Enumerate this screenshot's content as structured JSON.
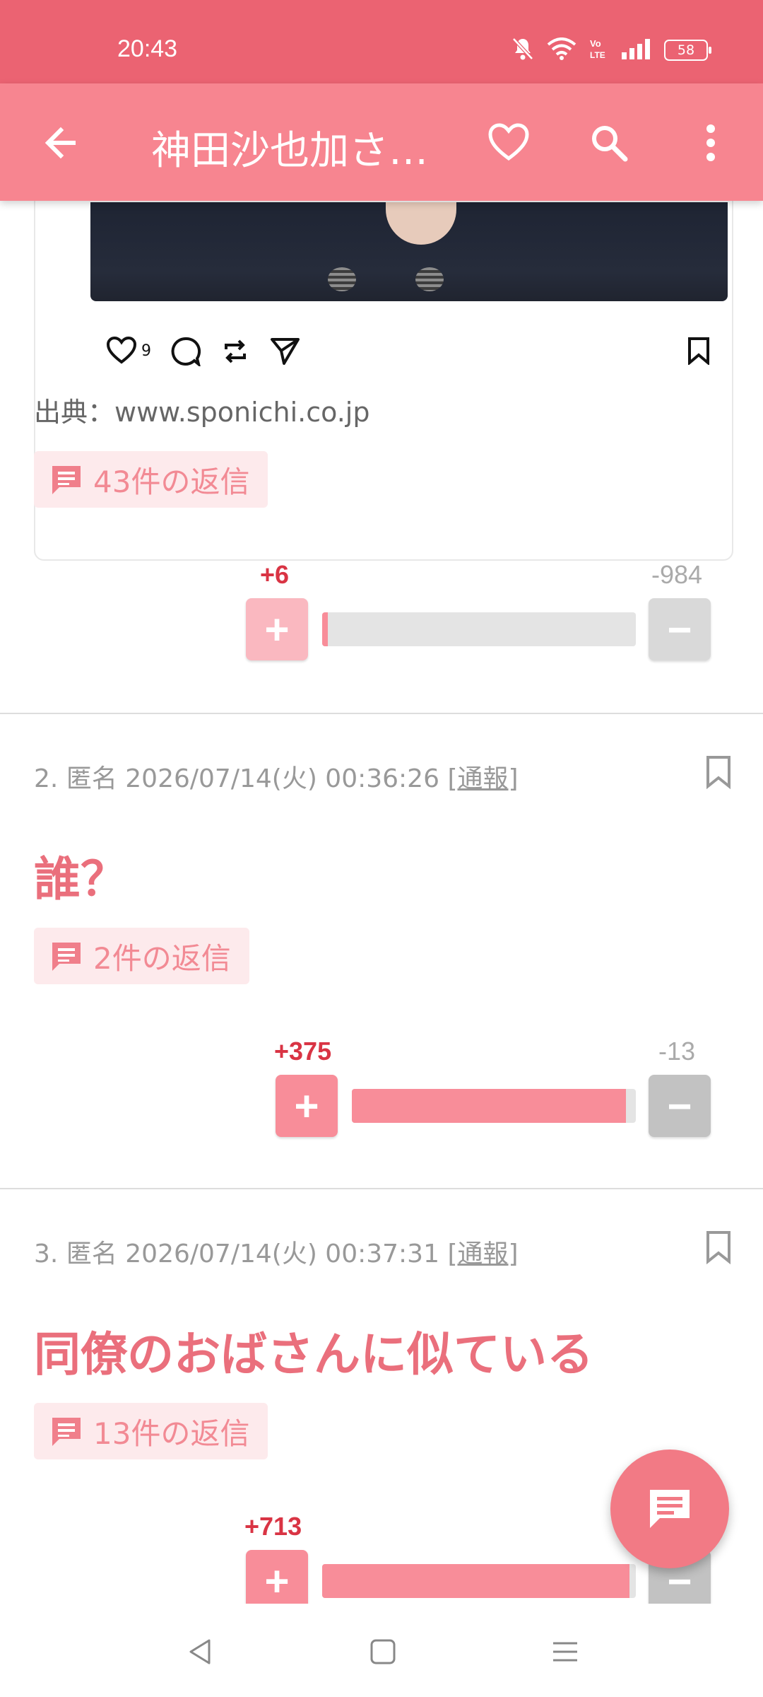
{
  "status_bar": {
    "time": "20:43",
    "battery": "58",
    "icons": [
      "bell-off-icon",
      "wifi-icon",
      "volte-icon",
      "signal-icon",
      "battery-icon"
    ]
  },
  "app_bar": {
    "title": "神田沙也加さ…",
    "icons": [
      "back-arrow-icon",
      "heart-icon",
      "search-icon",
      "more-vert-icon"
    ]
  },
  "embed": {
    "like_count": "9",
    "icons": [
      "heart-icon",
      "comment-icon",
      "repost-icon",
      "share-icon",
      "bookmark-icon"
    ]
  },
  "source": {
    "text": "出典：www.sponichi.co.jp"
  },
  "posts": [
    {
      "replies": "43件の返信",
      "plus": "+6",
      "minus": "-984",
      "plus_fraction": 0.006
    },
    {
      "number": "2.",
      "author": "匿名",
      "datetime": "2026/07/14(火) 00:36:26",
      "report": "通報",
      "body": "誰？",
      "replies": "2件の返信",
      "plus": "+375",
      "minus": "-13",
      "plus_fraction": 0.966
    },
    {
      "number": "3.",
      "author": "匿名",
      "datetime": "2026/07/14(火) 00:37:31",
      "report": "通報",
      "body": "同僚のおばさんに似ている",
      "replies": "13件の返信",
      "plus": "+713",
      "plus_fraction": 0.98
    }
  ],
  "colors": {
    "status_bar": "#eb6372",
    "app_bar": "#f78590",
    "accent": "#ea6f7c",
    "plus": "#d93444"
  },
  "nav": {
    "icons": [
      "back-triangle-icon",
      "home-square-icon",
      "recents-menu-icon"
    ]
  }
}
